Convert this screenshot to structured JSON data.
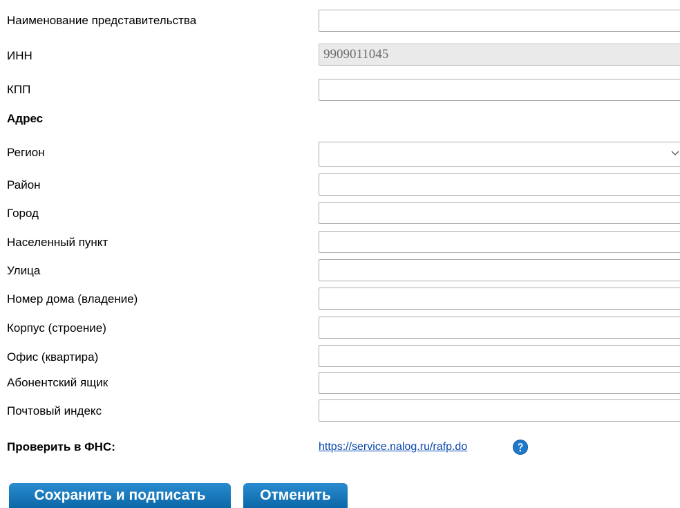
{
  "form": {
    "name_label": "Наименование представительства",
    "name_value": "",
    "inn_label": "ИНН",
    "inn_value": "9909011045",
    "kpp_label": "КПП",
    "kpp_value": "",
    "address_heading": "Адрес",
    "region_label": "Регион",
    "region_value": "",
    "district_label": "Район",
    "district_value": "",
    "city_label": "Город",
    "city_value": "",
    "locality_label": "Населенный пункт",
    "locality_value": "",
    "street_label": "Улица",
    "street_value": "",
    "house_label": "Номер дома (владение)",
    "house_value": "",
    "building_label": "Корпус (строение)",
    "building_value": "",
    "office_label": "Офис (квартира)",
    "office_value": "",
    "pobox_label": "Абонентский ящик",
    "pobox_value": "",
    "postcode_label": "Почтовый индекс",
    "postcode_value": ""
  },
  "check": {
    "label": "Проверить в ФНС:",
    "link_text": "https://service.nalog.ru/rafp.do",
    "help_icon": "question-circle-icon"
  },
  "buttons": {
    "save_label": "Сохранить и подписать",
    "cancel_label": "Отменить"
  },
  "colors": {
    "button_bg": "#0b68a8",
    "link": "#0645ad",
    "help_icon": "#1f78c8"
  }
}
